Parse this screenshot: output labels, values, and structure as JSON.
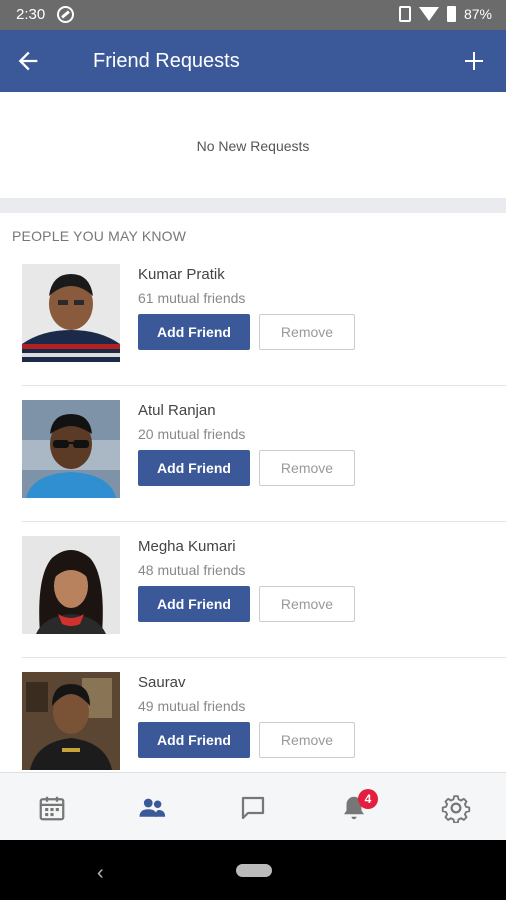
{
  "status_bar": {
    "time": "2:30",
    "battery_percent": "87%"
  },
  "app_bar": {
    "title": "Friend Requests"
  },
  "requests": {
    "empty_message": "No New Requests"
  },
  "pymk": {
    "header": "PEOPLE YOU MAY KNOW",
    "people": [
      {
        "name": "Kumar Pratik",
        "mutual": "61 mutual friends",
        "add_label": "Add Friend",
        "remove_label": "Remove"
      },
      {
        "name": "Atul Ranjan",
        "mutual": "20 mutual friends",
        "add_label": "Add Friend",
        "remove_label": "Remove"
      },
      {
        "name": "Megha Kumari",
        "mutual": "48 mutual friends",
        "add_label": "Add Friend",
        "remove_label": "Remove"
      },
      {
        "name": "Saurav",
        "mutual": "49 mutual friends",
        "add_label": "Add Friend",
        "remove_label": "Remove"
      }
    ]
  },
  "bottom_nav": {
    "tabs": [
      {
        "icon": "calendar-icon",
        "active": false
      },
      {
        "icon": "friends-icon",
        "active": true
      },
      {
        "icon": "messages-icon",
        "active": false
      },
      {
        "icon": "notifications-icon",
        "active": false,
        "badge": "4"
      },
      {
        "icon": "settings-icon",
        "active": false
      }
    ]
  },
  "colors": {
    "brand": "#3b5998",
    "badge": "#e41e3f",
    "inactive_icon": "#777777"
  }
}
